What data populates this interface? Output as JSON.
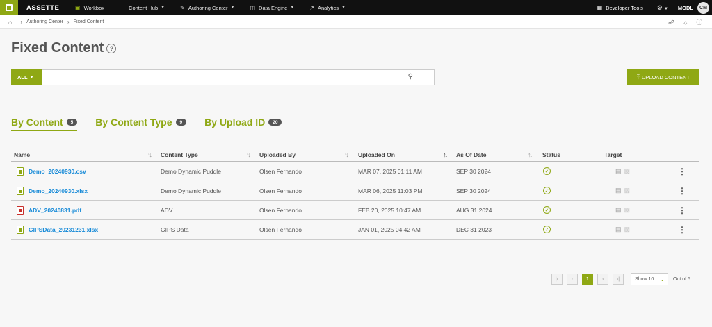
{
  "nav": {
    "brand": "ASSETTE",
    "items": [
      {
        "label": "Workbox",
        "icon": "workbox-icon",
        "dropdown": false
      },
      {
        "label": "Content Hub",
        "icon": "share-icon",
        "dropdown": true
      },
      {
        "label": "Authoring Center",
        "icon": "edit-icon",
        "dropdown": true
      },
      {
        "label": "Data Engine",
        "icon": "database-icon",
        "dropdown": true
      },
      {
        "label": "Analytics",
        "icon": "chart-icon",
        "dropdown": true
      }
    ],
    "dev_tools": "Developer Tools",
    "org": "MODL",
    "avatar": "CM",
    "accent": "#8fa814"
  },
  "breadcrumb": [
    "Authoring Center",
    "Fixed Content"
  ],
  "page_title": "Fixed Content",
  "search": {
    "filter": "ALL",
    "value": ""
  },
  "upload_label": "UPLOAD CONTENT",
  "tabs": [
    {
      "label": "By Content",
      "count": "5",
      "active": true
    },
    {
      "label": "By Content Type",
      "count": "9",
      "active": false
    },
    {
      "label": "By Upload ID",
      "count": "20",
      "active": false
    }
  ],
  "table": {
    "headers": [
      "Name",
      "Content Type",
      "Uploaded By",
      "Uploaded On",
      "As Of Date",
      "Status",
      "Target"
    ],
    "rows": [
      {
        "name": "Demo_20240930.csv",
        "type": "Demo Dynamic Puddle",
        "by": "Olsen Fernando",
        "on": "MAR 07, 2025 01:11 AM",
        "asof": "SEP 30 2024",
        "file": "csv"
      },
      {
        "name": "Demo_20240930.xlsx",
        "type": "Demo Dynamic Puddle",
        "by": "Olsen Fernando",
        "on": "MAR 06, 2025 11:03 PM",
        "asof": "SEP 30 2024",
        "file": "xlsx"
      },
      {
        "name": "ADV_20240831.pdf",
        "type": "ADV",
        "by": "Olsen Fernando",
        "on": "FEB 20, 2025 10:47 AM",
        "asof": "AUG 31 2024",
        "file": "pdf"
      },
      {
        "name": "GIPSData_20231231.xlsx",
        "type": "GIPS Data",
        "by": "Olsen Fernando",
        "on": "JAN 01, 2025 04:42 AM",
        "asof": "DEC 31 2023",
        "file": "xlsx"
      }
    ]
  },
  "pager": {
    "current": "1",
    "show": "Show 10",
    "out_of": "Out of 5"
  }
}
